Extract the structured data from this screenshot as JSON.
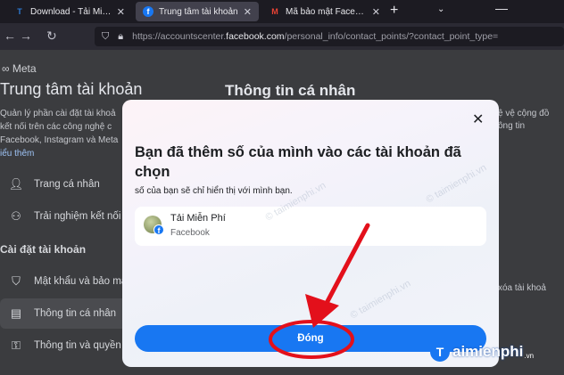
{
  "browser": {
    "tabs": [
      {
        "icon": "tai-mien-phi-favicon-icon",
        "label": "Download - Tải Miễn Phí VN",
        "active": false
      },
      {
        "icon": "facebook-favicon-icon",
        "label": "Trung tâm tài khoản",
        "active": true
      },
      {
        "icon": "gmail-favicon-icon",
        "label": "Mã bảo mật Facebook của",
        "active": false
      }
    ],
    "url_prefix": "https://accountscenter.",
    "url_domain": "facebook.com",
    "url_path": "/personal_info/contact_points/?contact_point_type="
  },
  "background_page": {
    "logo_text": "∞ Meta",
    "title": "Trung tâm tài khoản",
    "description_lines": [
      "Quản lý phần cài đặt tài khoả",
      "kết nối trên các công nghệ c",
      "Facebook, Instagram và Meta"
    ],
    "learn_more": "iểu thêm",
    "nav_items": [
      {
        "icon": "profile-icon",
        "label": "Trang cá nhân",
        "active": false
      },
      {
        "icon": "connected-experiences-icon",
        "label": "Trải nghiệm kết nối",
        "active": false
      }
    ],
    "settings_header": "Cài đặt tài khoản",
    "settings_items": [
      {
        "icon": "shield-icon",
        "label": "Mật khẩu và bảo mật",
        "active": false
      },
      {
        "icon": "id-card-icon",
        "label": "Thông tin cá nhân",
        "active": true
      },
      {
        "icon": "privacy-icon",
        "label": "Thông tin và quyền",
        "active": false
      }
    ],
    "right_title": "Thông tin cá nhân",
    "right_fragment_1": "ệ vệ cộng đồ",
    "right_fragment_2": "ông tin",
    "right_fragment_3": "xóa tài khoả"
  },
  "modal": {
    "title": "Bạn đã thêm số của mình vào các tài khoản đã chọn",
    "subtitle": "số của bạn sẽ chỉ hiển thị với mình bạn.",
    "account": {
      "name": "Tải Miễn Phí",
      "platform": "Facebook"
    },
    "close_button": "Đóng"
  },
  "watermarks": {
    "diagonal": "© taimienphi.vn",
    "logo_text": "aimienphi",
    "logo_letter": "T",
    "logo_suffix": ".vn"
  },
  "colors": {
    "primary_button": "#1877f2",
    "annotation_red": "#e3101b"
  }
}
